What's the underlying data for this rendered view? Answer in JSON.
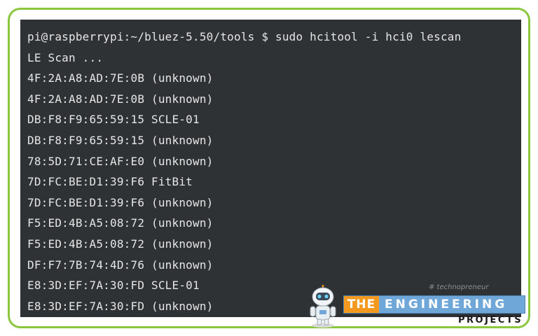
{
  "terminal": {
    "lines": [
      "pi@raspberrypi:~/bluez-5.50/tools $ sudo hcitool -i hci0 lescan",
      "LE Scan ...",
      "4F:2A:A8:AD:7E:0B (unknown)",
      "4F:2A:A8:AD:7E:0B (unknown)",
      "DB:F8:F9:65:59:15 SCLE-01",
      "DB:F8:F9:65:59:15 (unknown)",
      "78:5D:71:CE:AF:E0 (unknown)",
      "7D:FC:BE:D1:39:F6 FitBit",
      "7D:FC:BE:D1:39:F6 (unknown)",
      "F5:ED:4B:A5:08:72 (unknown)",
      "F5:ED:4B:A5:08:72 (unknown)",
      "DF:F7:7B:74:4D:76 (unknown)",
      "E8:3D:EF:7A:30:FD SCLE-01",
      "E8:3D:EF:7A:30:FD (unknown)"
    ]
  },
  "watermark": {
    "small_text": "# technopreneur",
    "banner_the": "THE",
    "banner_engineering": "ENGINEERING",
    "projects": "PROJECTS",
    "icon": "robot-icon"
  },
  "colors": {
    "frame_border": "#8cc63f",
    "terminal_bg": "#2e3234",
    "terminal_text": "#e6e6e6",
    "banner_blue": "#6fa8d8",
    "banner_orange": "#f39a1e"
  }
}
